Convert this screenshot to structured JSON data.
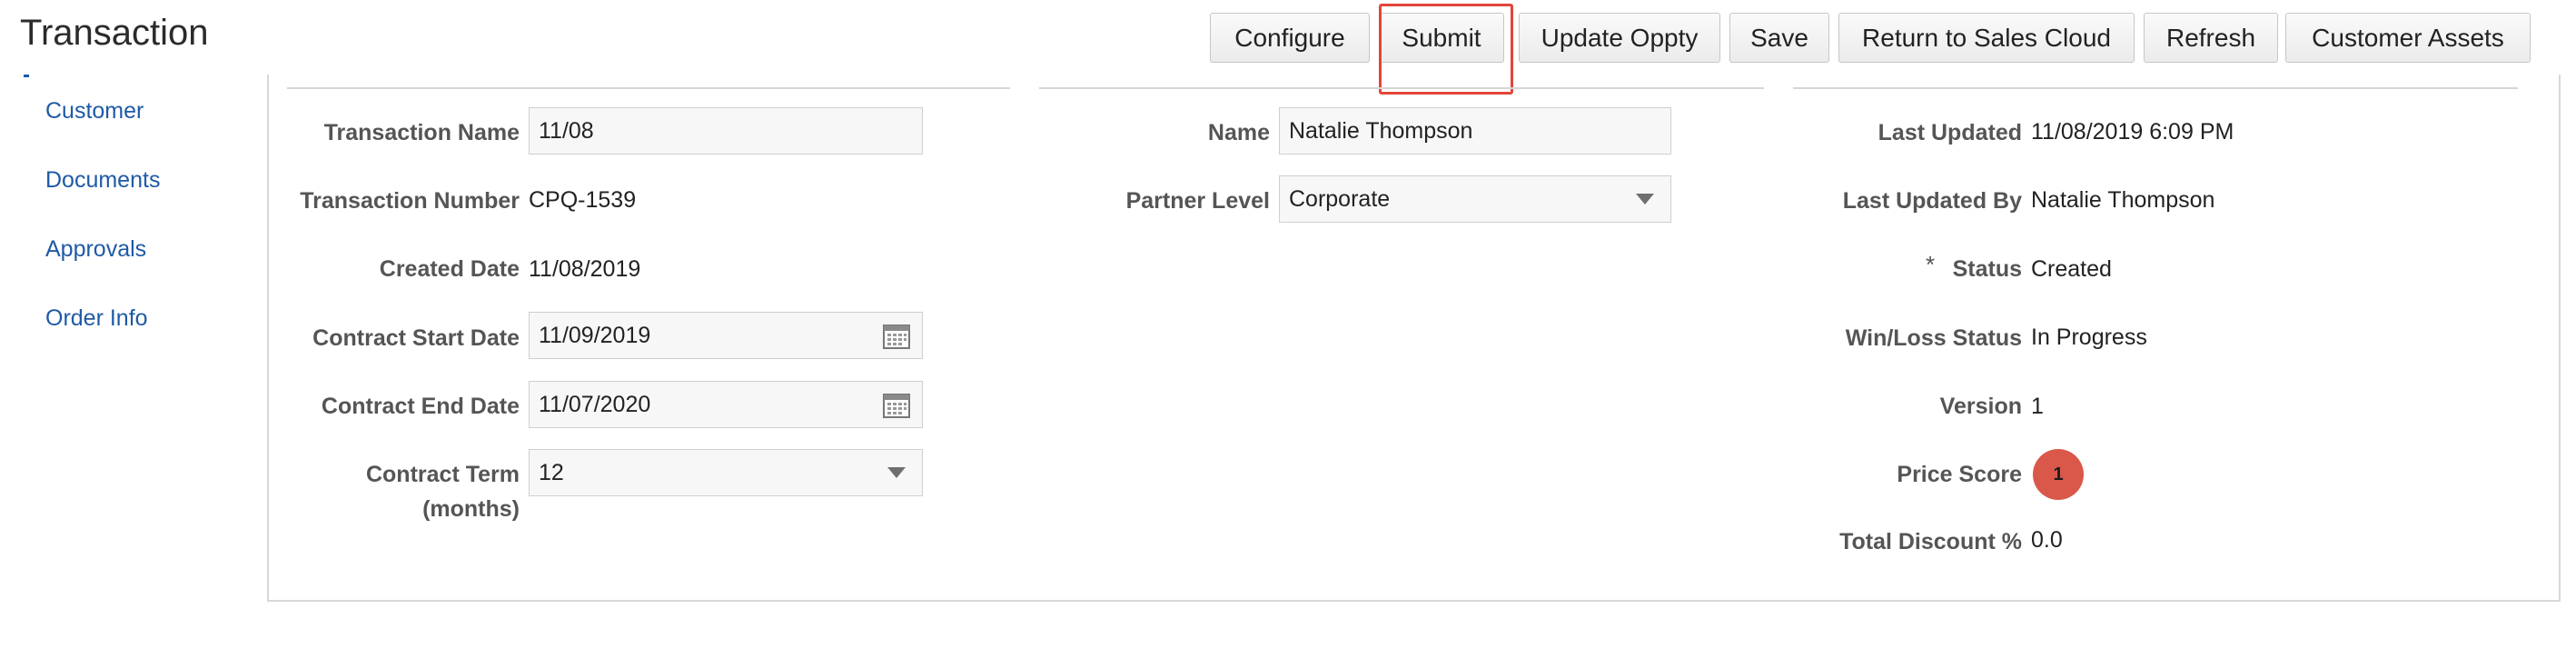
{
  "page": {
    "title": "Transaction"
  },
  "toolbar": {
    "configure": "Configure",
    "submit": "Submit",
    "update_oppty": "Update Oppty",
    "save": "Save",
    "return_to_sales_cloud": "Return to Sales Cloud",
    "refresh": "Refresh",
    "customer_assets": "Customer Assets",
    "highlight_color": "#e3453a"
  },
  "sidebar": {
    "items": [
      {
        "label": "Customer"
      },
      {
        "label": "Documents"
      },
      {
        "label": "Approvals"
      },
      {
        "label": "Order Info"
      }
    ]
  },
  "left_column": {
    "transaction_name": {
      "label": "Transaction Name",
      "value": "11/08"
    },
    "transaction_number": {
      "label": "Transaction Number",
      "value": "CPQ-1539"
    },
    "created_date": {
      "label": "Created Date",
      "value": "11/08/2019"
    },
    "contract_start_date": {
      "label": "Contract Start Date",
      "value": "11/09/2019",
      "icon": "calendar-icon"
    },
    "contract_end_date": {
      "label": "Contract End Date",
      "value": "11/07/2020",
      "icon": "calendar-icon"
    },
    "contract_term": {
      "label_line1": "Contract Term",
      "label_line2": "(months)",
      "value": "12",
      "icon": "chevron-down-icon"
    }
  },
  "middle_column": {
    "name": {
      "label": "Name",
      "value": "Natalie Thompson"
    },
    "partner_level": {
      "label": "Partner Level",
      "value": "Corporate",
      "icon": "chevron-down-icon"
    }
  },
  "right_column": {
    "last_updated": {
      "label": "Last Updated",
      "value": "11/08/2019 6:09 PM"
    },
    "last_updated_by": {
      "label": "Last Updated By",
      "value": "Natalie Thompson"
    },
    "status": {
      "required_marker": "*",
      "label": "Status",
      "value": "Created"
    },
    "win_loss_status": {
      "label": "Win/Loss Status",
      "value": "In Progress"
    },
    "version": {
      "label": "Version",
      "value": "1"
    },
    "price_score": {
      "label": "Price Score",
      "value": "1",
      "badge_color": "#d9584a"
    },
    "total_discount": {
      "label": "Total Discount %",
      "value": "0.0"
    }
  },
  "colors": {
    "link": "#1f5aa6",
    "label": "#555555",
    "border": "#d8d8d8"
  }
}
